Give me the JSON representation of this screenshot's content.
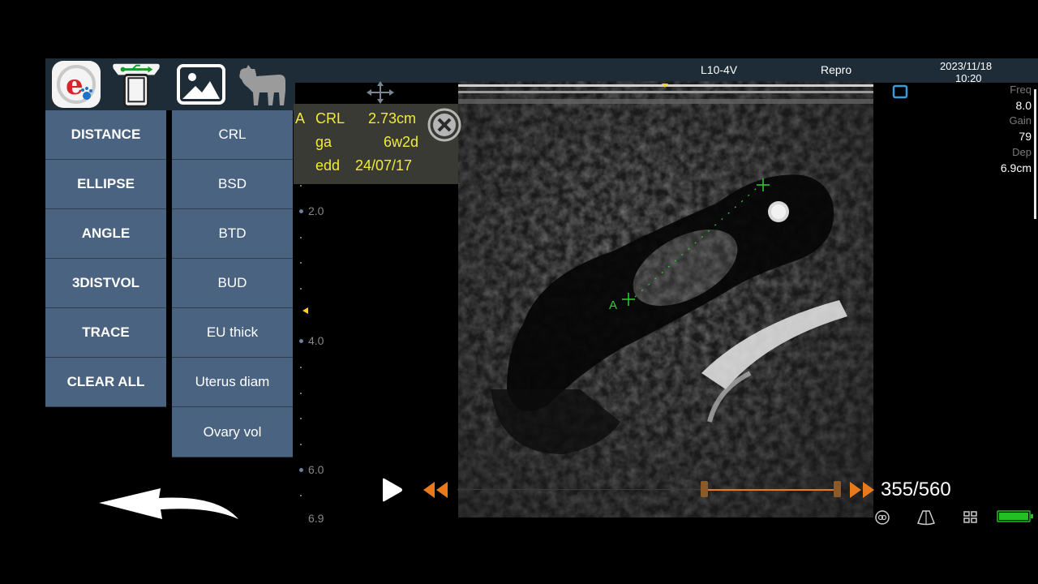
{
  "header": {
    "probe": "L10-4V",
    "mode": "Repro",
    "date": "2023/11/18",
    "time": "10:20"
  },
  "tools": [
    {
      "name": "e-vet-logo-icon"
    },
    {
      "name": "usb-probe-icon"
    },
    {
      "name": "image-gallery-icon"
    },
    {
      "name": "cow-icon"
    }
  ],
  "measure_menu": {
    "left": [
      "DISTANCE",
      "ELLIPSE",
      "ANGLE",
      "3DISTVOL",
      "TRACE",
      "CLEAR ALL"
    ],
    "right": [
      "CRL",
      "BSD",
      "BTD",
      "BUD",
      "EU thick",
      "Uterus diam",
      "Ovary vol"
    ]
  },
  "measurement": {
    "marker": "A",
    "rows": [
      {
        "label": "CRL",
        "value": "2.73cm"
      },
      {
        "label": "ga",
        "value": "6w2d"
      },
      {
        "label": "edd",
        "value": "24/07/17"
      }
    ]
  },
  "depth_scale": {
    "labels": [
      "2.0",
      "4.0",
      "6.0",
      "6.9"
    ]
  },
  "image_params": {
    "freq_label": "Freq",
    "freq_value": "8.0",
    "gain_label": "Gain",
    "gain_value": "79",
    "depth_label": "Dep",
    "depth_value": "6.9cm"
  },
  "caliper_label": "A",
  "cine": {
    "frame": "355/560",
    "current_frame": 355,
    "total_frames": 560
  },
  "colors": {
    "button_bg": "#4a6380",
    "topbar_bg": "#1e2c38",
    "measure_text": "#f0ea3c",
    "caliper": "#2fd22f",
    "cine_accent": "#e87a1c",
    "battery": "#22c022"
  }
}
